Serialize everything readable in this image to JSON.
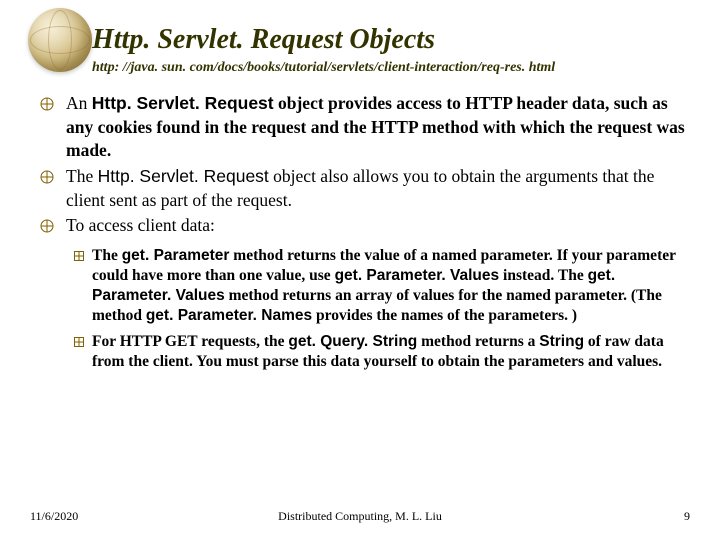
{
  "title": "Http. Servlet. Request Objects",
  "subtitle": "http: //java. sun. com/docs/books/tutorial/servlets/client-interaction/req-res. html",
  "bullets": [
    {
      "pre": "An ",
      "code1": "Http. Servlet. Request",
      "mid1": " object provides access to HTTP header data, such as any cookies found in the request and the HTTP method with which the request was made."
    },
    {
      "pre": "The ",
      "code1": "Http. Servlet. Request",
      "mid1": " object also allows you to obtain the arguments that the client sent as part of the request."
    },
    {
      "pre": "To access client data:"
    }
  ],
  "sub": [
    {
      "t1": "The ",
      "c1": "get. Parameter",
      "t2": " method returns the value of a named parameter. If your parameter could have more than one value, use ",
      "c2": "get. Parameter. Values",
      "t3": " instead. The ",
      "c3": "get. Parameter. Values",
      "t4": " method returns an array of values for the named parameter. (The method ",
      "c4": "get. Parameter. Names",
      "t5": " provides the names of the parameters. )"
    },
    {
      "t1": "For HTTP GET requests, the ",
      "c1": "get. Query. String",
      "t2": " method returns a ",
      "c2": "String",
      "t3": " of raw data from the client. You must parse this data yourself to obtain the parameters and values."
    }
  ],
  "footer": {
    "date": "11/6/2020",
    "center": "Distributed Computing, M. L. Liu",
    "page": "9"
  }
}
